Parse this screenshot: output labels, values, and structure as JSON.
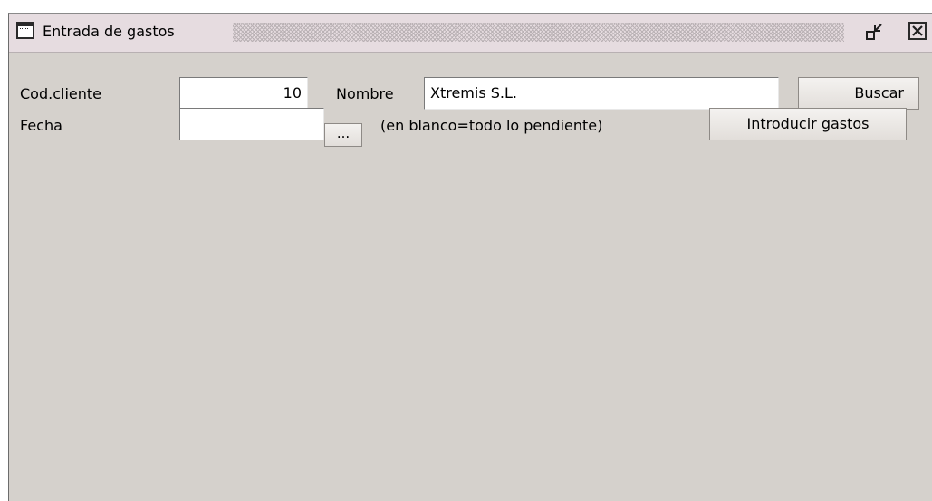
{
  "window": {
    "title": "Entrada de gastos"
  },
  "form": {
    "cod_cliente_label": "Cod.cliente",
    "cod_cliente_value": "10",
    "nombre_label": "Nombre",
    "nombre_value": "Xtremis S.L.",
    "buscar_label": "Buscar",
    "fecha_label": "Fecha",
    "fecha_value": "",
    "date_picker_label": "...",
    "fecha_hint": "(en blanco=todo lo pendiente)",
    "introducir_label": "Introducir gastos"
  },
  "icons": {
    "app": "window-icon",
    "restore": "restore-icon",
    "close": "close-icon"
  }
}
